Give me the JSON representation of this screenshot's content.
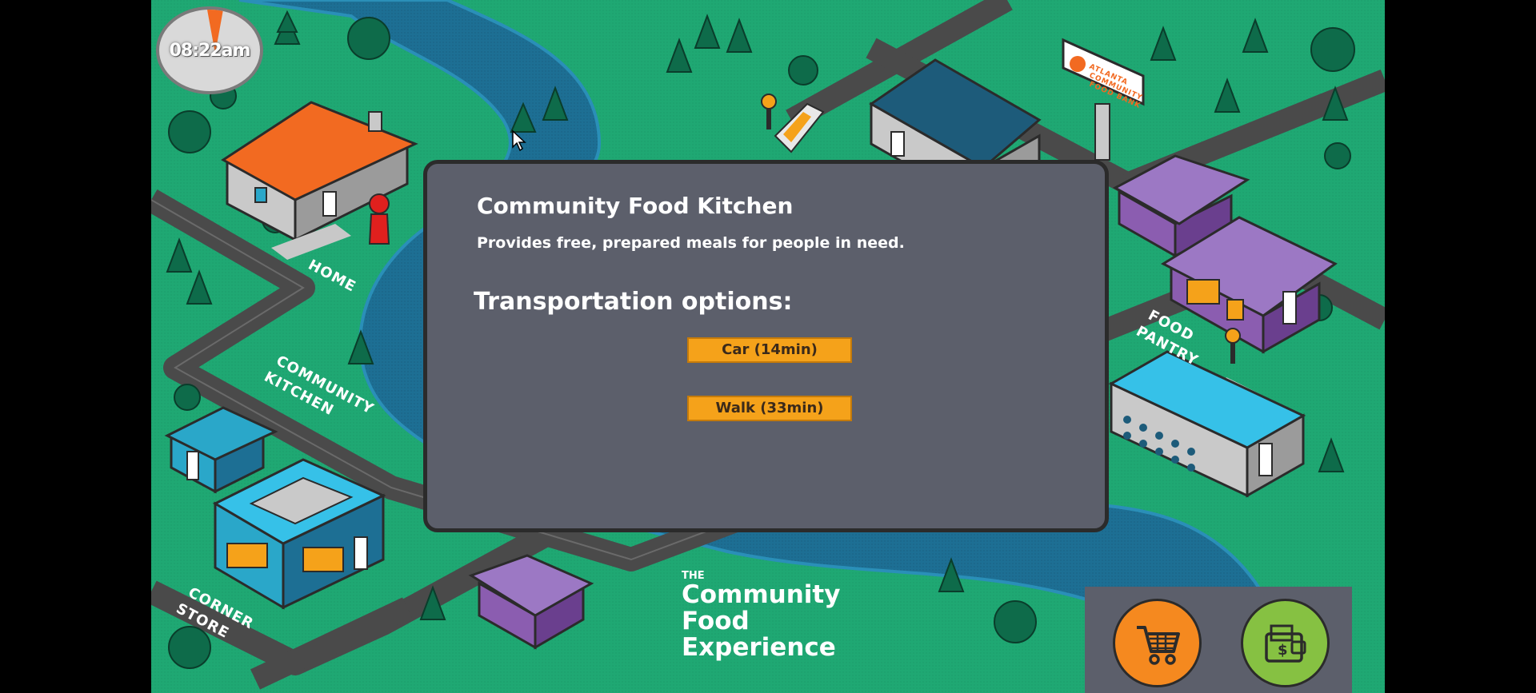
{
  "clock": {
    "time": "08:22am"
  },
  "map_labels": {
    "home": "HOME",
    "community_kitchen_1": "COMMUNITY",
    "community_kitchen_2": "KITCHEN",
    "corner_store_1": "CORNER",
    "corner_store_2": "STORE",
    "food_pantry_1": "FOOD",
    "food_pantry_2": "PANTRY",
    "billboard_1": "ATLANTA",
    "billboard_2": "COMMUNITY",
    "billboard_3": "FOOD BANK"
  },
  "dialog": {
    "title": "Community Food Kitchen",
    "description": "Provides free, prepared meals for people in need.",
    "subtitle": "Transportation options:",
    "options": [
      {
        "label": "Car (14min)"
      },
      {
        "label": "Walk (33min)"
      }
    ]
  },
  "brand": {
    "the": "THE",
    "line1": "Community",
    "line2": "Food",
    "line3": "Experience"
  },
  "toolbar": {
    "cart_icon": "shopping-cart-icon",
    "wallet_icon": "wallet-icon"
  },
  "colors": {
    "grass": "#1fa873",
    "road": "#4a4a4a",
    "river": "#1d6f94",
    "dialog_bg": "#5c5f6b",
    "button": "#f5a21a",
    "orange_roof": "#f26a21",
    "purple_house": "#8b5db0",
    "teal_building": "#2aa7c9",
    "cart_button": "#f5891f",
    "wallet_button": "#86c142"
  }
}
